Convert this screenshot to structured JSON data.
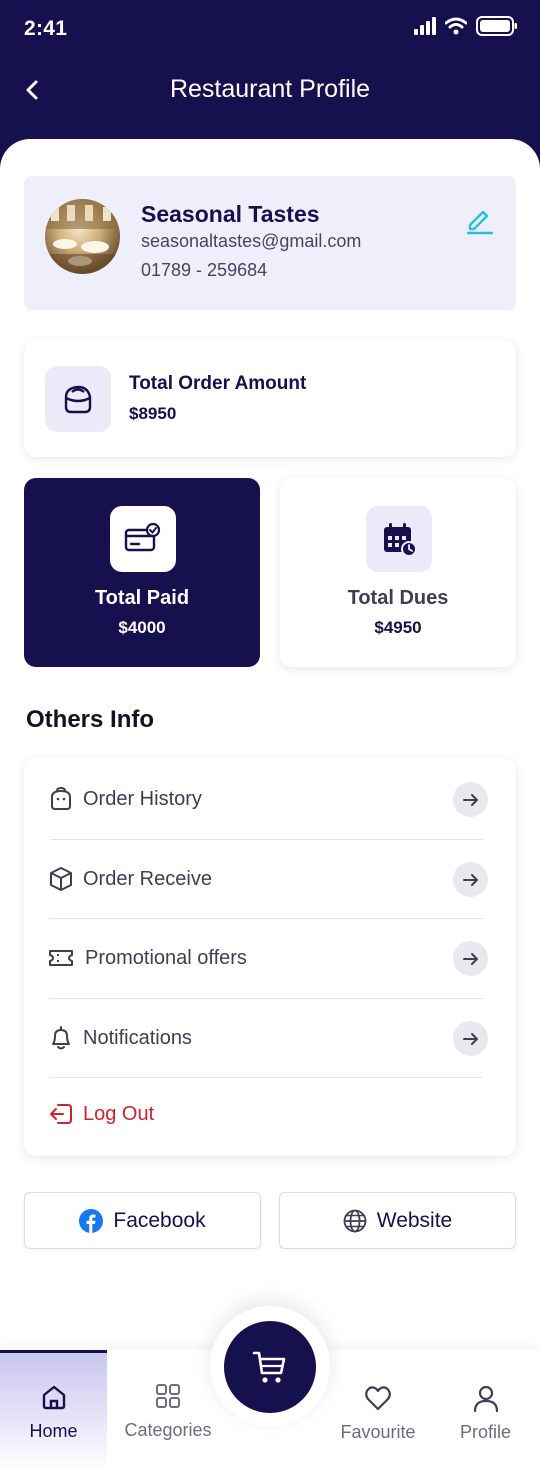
{
  "status_bar": {
    "time": "2:41"
  },
  "header": {
    "title": "Restaurant Profile"
  },
  "profile": {
    "name": "Seasonal Tastes",
    "email": "seasonaltastes@gmail.com",
    "phone": "01789 - 259684"
  },
  "total_order": {
    "label": "Total Order Amount",
    "value": "$8950"
  },
  "total_paid": {
    "label": "Total Paid",
    "value": "$4000"
  },
  "total_dues": {
    "label": "Total Dues",
    "value": "$4950"
  },
  "others_info": {
    "title": "Others Info",
    "items": [
      {
        "label": "Order History",
        "icon": "shopping-bag-icon"
      },
      {
        "label": "Order Receive",
        "icon": "box-icon"
      },
      {
        "label": "Promotional offers",
        "icon": "ticket-icon"
      },
      {
        "label": "Notifications",
        "icon": "bell-icon"
      }
    ],
    "logout": {
      "label": "Log Out",
      "icon": "logout-icon"
    }
  },
  "social": {
    "facebook": "Facebook",
    "website": "Website"
  },
  "bottom_nav": {
    "items": [
      {
        "label": "Home",
        "icon": "home-icon",
        "active": true
      },
      {
        "label": "Categories",
        "icon": "grid-icon"
      },
      {
        "label": "Favourite",
        "icon": "heart-icon"
      },
      {
        "label": "Profile",
        "icon": "user-icon"
      }
    ],
    "cart_icon": "cart-icon"
  },
  "colors": {
    "primary": "#17104f",
    "accent_edit": "#27c1e0",
    "danger": "#d0222a",
    "card_tint": "#efeefb",
    "facebook_blue": "#1877f2"
  }
}
